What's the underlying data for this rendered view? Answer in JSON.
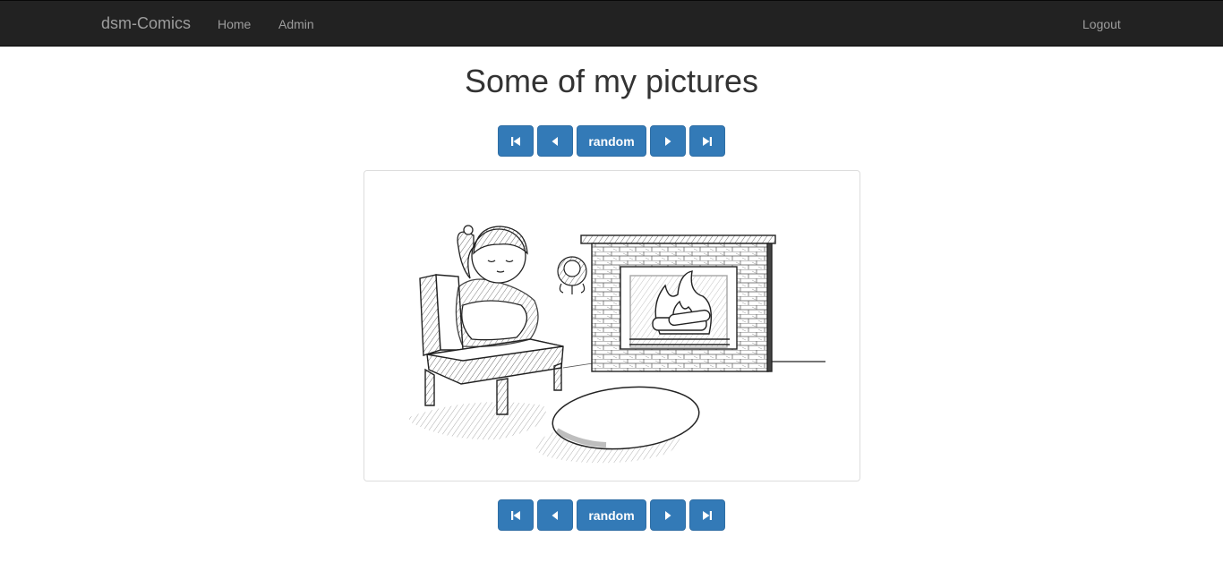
{
  "navbar": {
    "brand": "dsm-Comics",
    "links": [
      "Home",
      "Admin"
    ],
    "logout": "Logout",
    "background": "#222222",
    "link_color": "#9d9d9d"
  },
  "page": {
    "title": "Some of my pictures"
  },
  "pager": {
    "first_icon": "step-backward-icon",
    "prev_icon": "triangle-left-icon",
    "random_label": "random",
    "next_icon": "triangle-right-icon",
    "last_icon": "step-forward-icon",
    "button_color": "#337ab7"
  },
  "comic": {
    "alt": "Comic picture"
  }
}
